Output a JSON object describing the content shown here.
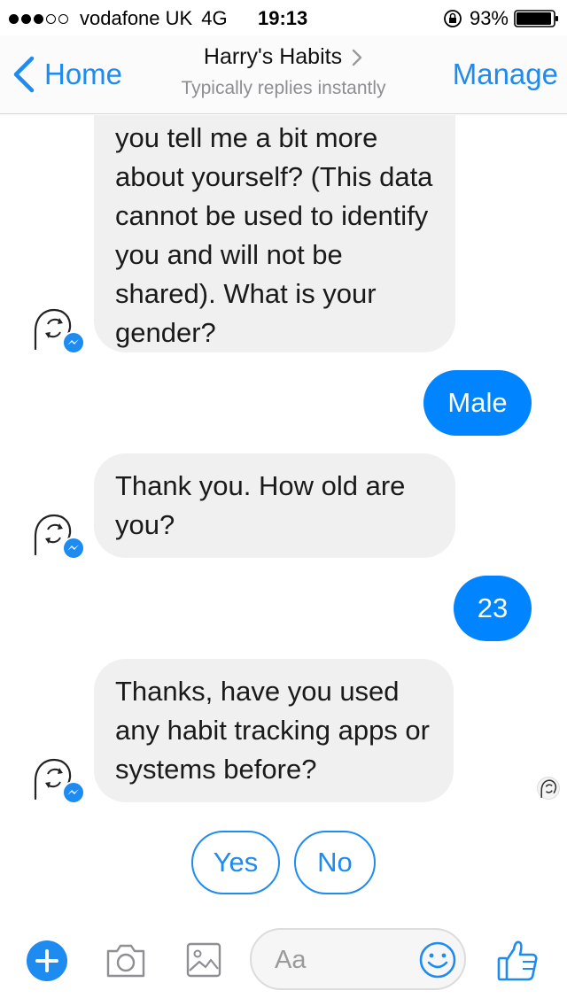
{
  "status_bar": {
    "carrier": "vodafone UK",
    "network": "4G",
    "time": "19:13",
    "battery": "93%",
    "signal_bars_filled": 3,
    "signal_bars_total": 5
  },
  "nav": {
    "back_label": "Home",
    "title": "Harry's Habits",
    "subtitle": "Typically replies instantly",
    "manage_label": "Manage"
  },
  "messages": [
    {
      "from": "bot",
      "text": "you tell me a bit more about yourself? (This data cannot be used to identify you and will not be shared). What is your gender?"
    },
    {
      "from": "user",
      "text": "Male"
    },
    {
      "from": "bot",
      "text": "Thank you. How old are you?"
    },
    {
      "from": "user",
      "text": "23"
    },
    {
      "from": "bot",
      "text": "Thanks, have you used any habit tracking apps or systems before?"
    }
  ],
  "quick_replies": [
    "Yes",
    "No"
  ],
  "composer": {
    "placeholder": "Aa"
  },
  "icons": {
    "back": "chevron-left-icon",
    "title_disclosure": "chevron-right-icon",
    "bot_avatar": "refresh-head-avatar-icon",
    "messenger_badge": "messenger-bolt-icon",
    "plus": "plus-icon",
    "camera": "camera-icon",
    "gallery": "image-icon",
    "emoji": "smiley-icon",
    "like": "thumbs-up-icon"
  },
  "colors": {
    "accent": "#1d8bf0",
    "outgoing_bubble": "#0084ff",
    "incoming_bubble": "#f0f0f0"
  }
}
